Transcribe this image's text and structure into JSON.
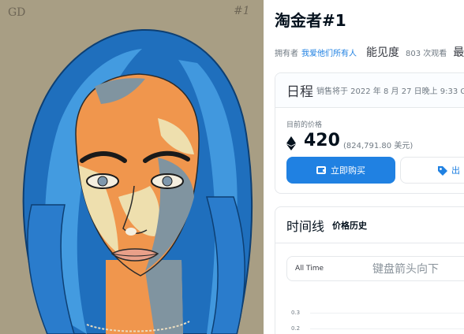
{
  "artwork": {
    "signature_left": "GD",
    "signature_right": "#1",
    "colors": {
      "background": "#a89e84",
      "hair": "#1f6fbd",
      "hair_highlight": "#4aa3e6",
      "skin_orange": "#f0964d",
      "skin_cream": "#eedfae",
      "skin_shadow": "#8094a0"
    }
  },
  "item": {
    "title": "淘金者#1",
    "owner_prefix": "拥有者",
    "owner_name": "我爱他们所有人",
    "visibility_label": "能见度",
    "view_count": "803 次观看",
    "extra_char": "最"
  },
  "sale": {
    "schedule_label": "日程",
    "sale_end_text": "销售将于 2022 年 8 月 27 日晚上 9:33 G",
    "current_price_label": "目前的价格",
    "currency_icon": "ethereum-icon",
    "price": "420",
    "fiat_price": "(824,791.80 美元)",
    "buy_now_label": "立即购买",
    "offer_label": "出"
  },
  "history": {
    "timeline_label": "时间线",
    "price_history_label": "价格历史",
    "filter_value": "All Time",
    "filter_hint": "键盘箭头向下",
    "y_ticks": [
      "0.3",
      "0.2"
    ]
  },
  "colors": {
    "accent": "#2081e2",
    "border": "#e5e8eb",
    "muted_text": "#707a83"
  }
}
